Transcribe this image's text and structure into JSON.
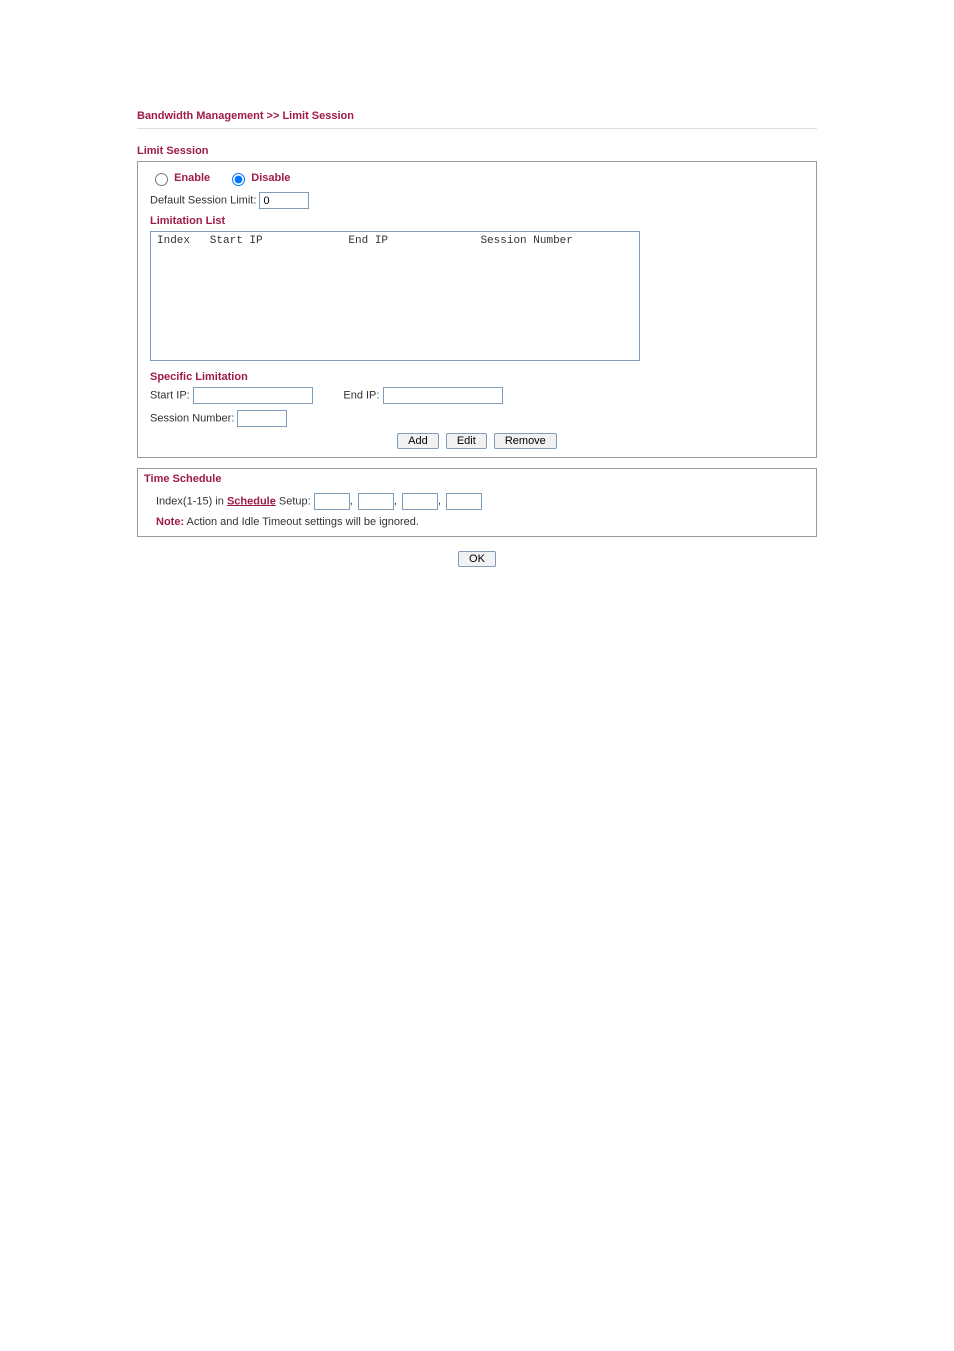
{
  "breadcrumb": "Bandwidth Management >> Limit Session",
  "section_title": "Limit Session",
  "enable_disable": {
    "enable_label": "Enable",
    "disable_label": "Disable",
    "selected": "disable"
  },
  "default_limit_label": "Default Session Limit:",
  "default_limit_value": "0",
  "limitation_list_title": "Limitation List",
  "list_header": "Index   Start IP             End IP              Session Number",
  "specific_title": "Specific Limitation",
  "start_ip_label": "Start IP:",
  "start_ip_value": "",
  "end_ip_label": "End IP:",
  "end_ip_value": "",
  "session_number_label": "Session Number:",
  "session_number_value": "",
  "buttons": {
    "add": "Add",
    "edit": "Edit",
    "remove": "Remove",
    "ok": "OK"
  },
  "time_schedule": {
    "title": "Time Schedule",
    "prefix": "Index(1-15) in ",
    "link": "Schedule",
    "suffix": " Setup:",
    "values": [
      "",
      "",
      "",
      ""
    ],
    "note_label": "Note:",
    "note_text": " Action and Idle Timeout settings will be ignored."
  }
}
